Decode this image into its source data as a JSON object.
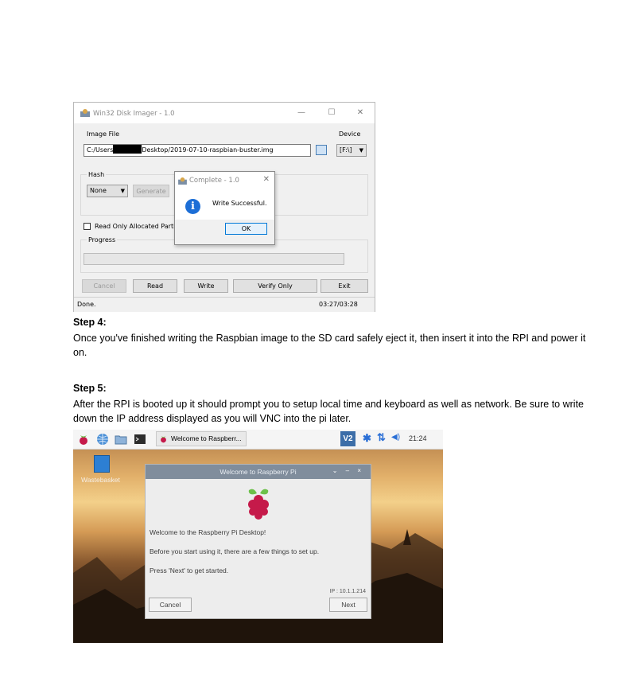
{
  "disk_imager": {
    "title": "Win32 Disk Imager - 1.0",
    "image_file_label": "Image File",
    "path_prefix": "C:/Users",
    "path_suffix": "Desktop/2019-07-10-raspbian-buster.img",
    "device_label": "Device",
    "device_value": "[F:\\]",
    "hash_label": "Hash",
    "hash_value": "None",
    "generate_label": "Generate",
    "read_only_label": "Read Only Allocated Partiti",
    "progress_label": "Progress",
    "buttons": {
      "cancel": "Cancel",
      "read": "Read",
      "write": "Write",
      "verify": "Verify Only",
      "exit": "Exit"
    },
    "status": "Done.",
    "elapsed": "03:27/03:28",
    "dialog": {
      "title": "Complete - 1.0",
      "message": "Write Successful.",
      "ok": "OK"
    }
  },
  "step4": {
    "heading": "Step 4:",
    "text": "Once you've finished writing the Raspbian image to the SD card safely eject it, then insert it into the RPI and power it on."
  },
  "step5": {
    "heading": "Step 5:",
    "text": "After the RPI is booted up it should prompt you to setup local time and keyboard as well as network. Be sure to write down the IP address displayed as you will VNC into the pi later."
  },
  "rpi_desktop": {
    "taskbar_item": "Welcome to Raspberr...",
    "vnc_label": "V2",
    "clock": "21:24",
    "wastebasket": "Wastebasket",
    "welcome": {
      "title": "Welcome to Raspberry Pi",
      "controls": "⌄ – ×",
      "line1": "Welcome to the Raspberry Pi Desktop!",
      "line2": "Before you start using it, there are a few things to set up.",
      "line3": "Press 'Next' to get started.",
      "ip": "IP : 10.1.1.214",
      "cancel": "Cancel",
      "next": "Next"
    }
  },
  "colors": {
    "rpi_title_bar": "#808d9c",
    "info_blue": "#1c6ed6",
    "ok_border": "#0078d7",
    "rpi_accent": "#c51a4a"
  }
}
